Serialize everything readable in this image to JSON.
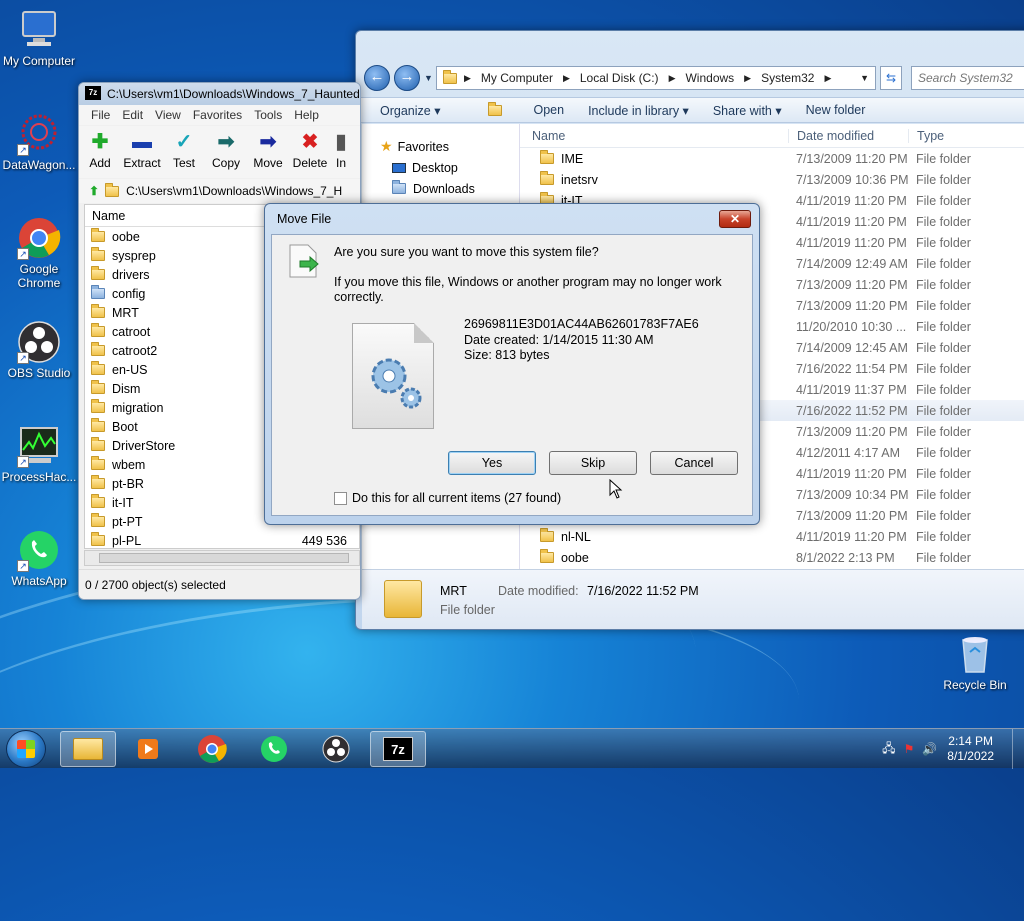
{
  "desktop": {
    "icons": [
      {
        "label": "My Computer"
      },
      {
        "label": "DataWagon..."
      },
      {
        "label": "Google Chrome"
      },
      {
        "label": "OBS Studio"
      },
      {
        "label": "ProcessHac..."
      },
      {
        "label": "WhatsApp"
      },
      {
        "label": "Recycle Bin"
      }
    ]
  },
  "explorer": {
    "breadcrumb": [
      "My Computer",
      "Local Disk (C:)",
      "Windows",
      "System32"
    ],
    "search_placeholder": "Search System32",
    "toolbar": [
      "Organize ▾",
      "Open",
      "Include in library ▾",
      "Share with ▾",
      "New folder"
    ],
    "sidebar": [
      "Favorites",
      "Desktop",
      "Downloads"
    ],
    "columns": {
      "name": "Name",
      "date": "Date modified",
      "type": "Type"
    },
    "rows": [
      {
        "name": "IME",
        "date": "7/13/2009 11:20 PM",
        "type": "File folder"
      },
      {
        "name": "inetsrv",
        "date": "7/13/2009 10:36 PM",
        "type": "File folder"
      },
      {
        "name": "it-IT",
        "date": "4/11/2019 11:20 PM",
        "type": "File folder"
      },
      {
        "name": "",
        "date": "4/11/2019 11:20 PM",
        "type": "File folder"
      },
      {
        "name": "",
        "date": "4/11/2019 11:20 PM",
        "type": "File folder"
      },
      {
        "name": "",
        "date": "7/14/2009 12:49 AM",
        "type": "File folder"
      },
      {
        "name": "",
        "date": "7/13/2009 11:20 PM",
        "type": "File folder"
      },
      {
        "name": "",
        "date": "7/13/2009 11:20 PM",
        "type": "File folder"
      },
      {
        "name": "",
        "date": "11/20/2010 10:30 ...",
        "type": "File folder"
      },
      {
        "name": "",
        "date": "7/14/2009 12:45 AM",
        "type": "File folder"
      },
      {
        "name": "",
        "date": "7/16/2022 11:54 PM",
        "type": "File folder"
      },
      {
        "name": "",
        "date": "4/11/2019 11:37 PM",
        "type": "File folder"
      },
      {
        "name": "",
        "date": "7/16/2022 11:52 PM",
        "type": "File folder"
      },
      {
        "name": "",
        "date": "7/13/2009 11:20 PM",
        "type": "File folder"
      },
      {
        "name": "",
        "date": "4/12/2011 4:17 AM",
        "type": "File folder"
      },
      {
        "name": "",
        "date": "4/11/2019 11:20 PM",
        "type": "File folder"
      },
      {
        "name": "",
        "date": "7/13/2009 10:34 PM",
        "type": "File folder"
      },
      {
        "name": "",
        "date": "7/13/2009 11:20 PM",
        "type": "File folder"
      },
      {
        "name": "nl-NL",
        "date": "4/11/2019 11:20 PM",
        "type": "File folder"
      },
      {
        "name": "oobe",
        "date": "8/1/2022 2:13 PM",
        "type": "File folder"
      }
    ],
    "details": {
      "name": "MRT",
      "modified_label": "Date modified:",
      "modified": "7/16/2022 11:52 PM",
      "type": "File folder"
    }
  },
  "sevenzip": {
    "title": "C:\\Users\\vm1\\Downloads\\Windows_7_Haunted",
    "menu": [
      "File",
      "Edit",
      "View",
      "Favorites",
      "Tools",
      "Help"
    ],
    "tools": [
      "Add",
      "Extract",
      "Test",
      "Copy",
      "Move",
      "Delete",
      "In"
    ],
    "path": "C:\\Users\\vm1\\Downloads\\Windows_7_H",
    "column_name": "Name",
    "items": [
      {
        "name": "oobe",
        "size": ""
      },
      {
        "name": "sysprep",
        "size": ""
      },
      {
        "name": "drivers",
        "size": ""
      },
      {
        "name": "config",
        "size": ""
      },
      {
        "name": "MRT",
        "size": ""
      },
      {
        "name": "catroot",
        "size": ""
      },
      {
        "name": "catroot2",
        "size": ""
      },
      {
        "name": "en-US",
        "size": ""
      },
      {
        "name": "Dism",
        "size": ""
      },
      {
        "name": "migration",
        "size": ""
      },
      {
        "name": "Boot",
        "size": ""
      },
      {
        "name": "DriverStore",
        "size": ""
      },
      {
        "name": "wbem",
        "size": ""
      },
      {
        "name": "pt-BR",
        "size": ""
      },
      {
        "name": "it-IT",
        "size": ""
      },
      {
        "name": "pt-PT",
        "size": ""
      },
      {
        "name": "pl-PL",
        "size": "449 536"
      }
    ],
    "status": "0 / 2700 object(s) selected"
  },
  "dialog": {
    "title": "Move File",
    "close": "✕",
    "question": "Are you sure you want to move this system file?",
    "message": "If you move this file, Windows or another program may no longer work correctly.",
    "file_name": "26969811E3D01AC44AB62601783F7AE6",
    "file_created": "Date created: 1/14/2015 11:30 AM",
    "file_size": "Size: 813 bytes",
    "yes": "Yes",
    "skip": "Skip",
    "cancel": "Cancel",
    "checkbox": "Do this for all current items (27 found)"
  },
  "taskbar": {
    "time": "2:14 PM",
    "date": "8/1/2022"
  }
}
